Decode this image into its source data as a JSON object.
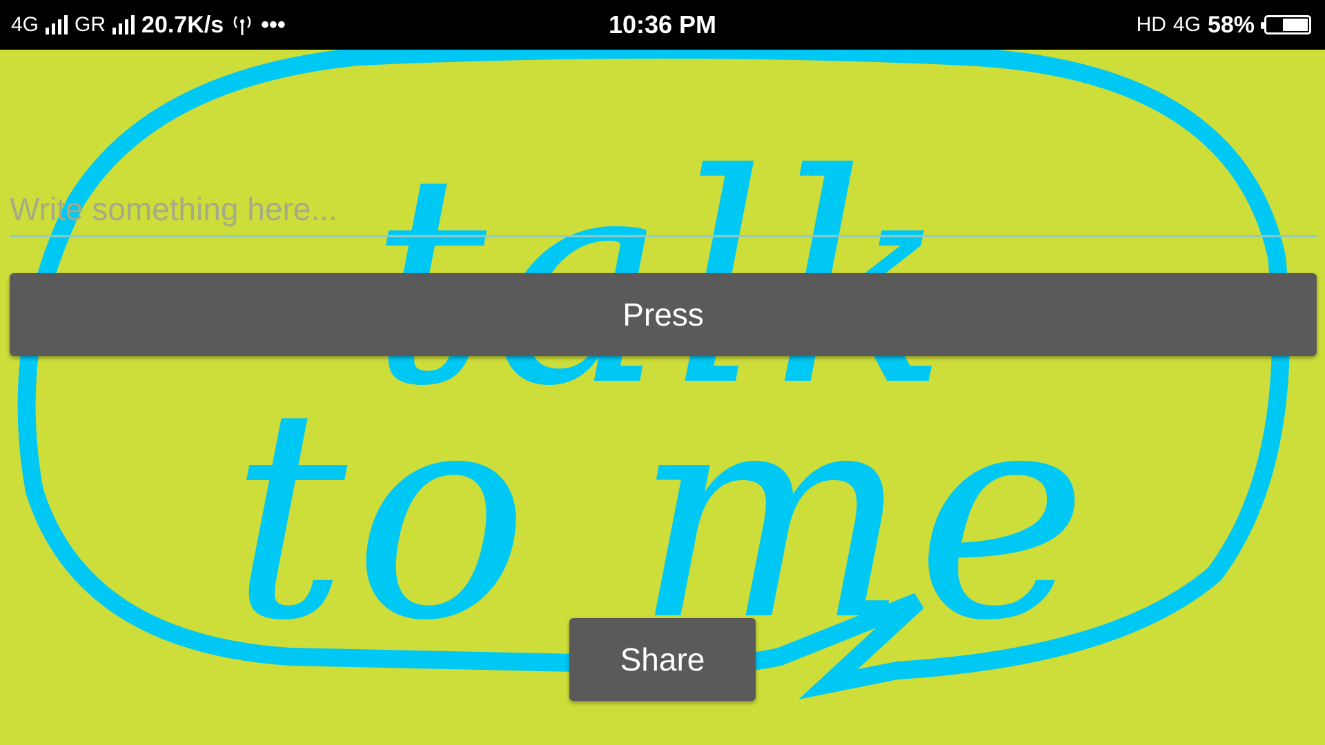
{
  "status_bar": {
    "network_1": "4G",
    "network_2": "GR",
    "data_speed": "20.7K/s",
    "hotspot_icon": "hotspot-icon",
    "more_icon": "•••",
    "time": "10:36 PM",
    "hd_label": "HD",
    "network_right": "4G",
    "battery": "58%"
  },
  "background": {
    "image_text_line1": "talk",
    "image_text_line2": "to me",
    "image_color": "#00c8f5",
    "background_color": "#cddd3a"
  },
  "input": {
    "placeholder": "Write something here...",
    "value": ""
  },
  "buttons": {
    "press_label": "Press",
    "share_label": "Share"
  }
}
